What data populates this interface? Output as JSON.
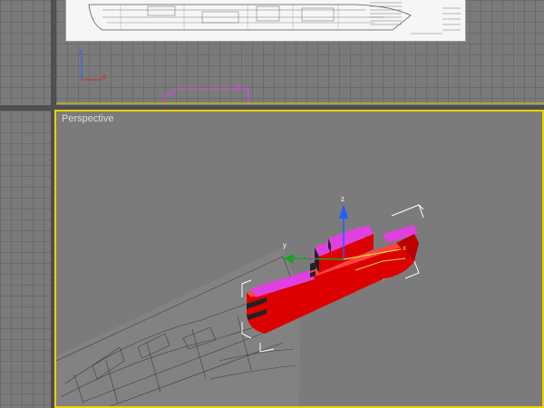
{
  "app": {
    "name": "3D modeling viewports"
  },
  "viewports": {
    "perspective": {
      "label": "Perspective",
      "active_border_color": "#e8d200"
    }
  },
  "gizmo": {
    "x_label": "x",
    "y_label": "y",
    "z_label": "z",
    "colors": {
      "x": "#e02020",
      "y": "#20a020",
      "z": "#2060ff"
    }
  },
  "ship": {
    "hull_color": "#dd0000",
    "deck_color": "#e040e0"
  }
}
